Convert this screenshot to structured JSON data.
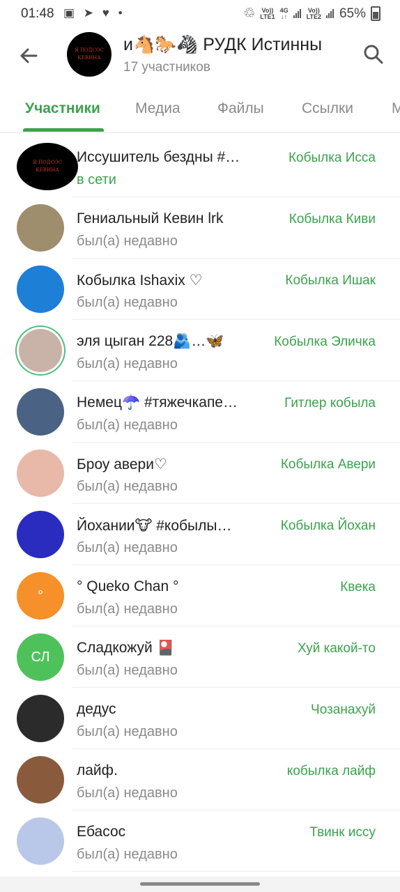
{
  "status_bar": {
    "time": "01:48",
    "left_icons": "▣ ➤ ♥ •",
    "sim1": [
      "Vo))",
      "LTE1"
    ],
    "net": [
      "4G",
      "↓↑"
    ],
    "sim2": [
      "Vo))",
      "LTE2"
    ],
    "battery": "65%"
  },
  "header": {
    "title": "и🐴🐎🦓 РУДК   Истинны",
    "subtitle": "17 участников",
    "avatar_text": [
      "Я ПОДСОС",
      "КЕВИНА"
    ]
  },
  "tabs": [
    {
      "label": "Участники"
    },
    {
      "label": "Медиа"
    },
    {
      "label": "Файлы"
    },
    {
      "label": "Ссылки"
    },
    {
      "label": "М"
    }
  ],
  "members": [
    {
      "name": "Иссушитель бездны #…",
      "status": "в сети",
      "role": "Кобылка Исса",
      "avatar_color": "#000000",
      "avatar_text": "Я ПОДСОС КЕВИНА"
    },
    {
      "name": "Гениальный Кевин lrk",
      "status": "был(а) недавно",
      "role": "Кобылка Киви",
      "avatar_color": "#9e8e6e",
      "avatar_text": ""
    },
    {
      "name": "Кобылка Ishaxix ♡",
      "status": "был(а) недавно",
      "role": "Кобылка Ишак",
      "avatar_color": "#1e7fd6",
      "avatar_text": ""
    },
    {
      "name": "эля цыган 228🫂…🦋",
      "status": "был(а) недавно",
      "role": "Кобылка Эличка",
      "avatar_color": "#c9b2a8",
      "avatar_text": ""
    },
    {
      "name": "Немец☂️ #тяжечкапе…",
      "status": "был(а) недавно",
      "role": "Гитлер кобыла",
      "avatar_color": "#4a6283",
      "avatar_text": ""
    },
    {
      "name": "Броу авери♡",
      "status": "был(а) недавно",
      "role": "Кобылка Авери",
      "avatar_color": "#e8b9a8",
      "avatar_text": ""
    },
    {
      "name": "Йохании🐮 #кобылы…",
      "status": "был(а) недавно",
      "role": "Кобылка Йохан",
      "avatar_color": "#2a2cc0",
      "avatar_text": ""
    },
    {
      "name": "° Queko Chan °",
      "status": "был(а) недавно",
      "role": "Квека",
      "avatar_color": "#f5902a",
      "avatar_text": "°"
    },
    {
      "name": "Сладкожуй 🎴",
      "status": "был(а) недавно",
      "role": "Хуй какой-то",
      "avatar_color": "#4fc15a",
      "avatar_text": "СЛ"
    },
    {
      "name": "дедус",
      "status": "был(а) недавно",
      "role": "Чозанахуй",
      "avatar_color": "#2b2b2b",
      "avatar_text": ""
    },
    {
      "name": "лайф.",
      "status": "был(а) недавно",
      "role": "кобылка лайф",
      "avatar_color": "#8a5a3c",
      "avatar_text": ""
    },
    {
      "name": "Ебасос",
      "status": "был(а) недавно",
      "role": "Твинк иссу",
      "avatar_color": "#b9c8e8",
      "avatar_text": ""
    }
  ],
  "colors": {
    "accent": "#3ca24c",
    "secondary_text": "#8a8a8a"
  }
}
